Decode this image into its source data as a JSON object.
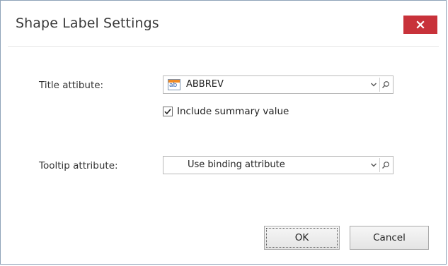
{
  "dialog": {
    "title": "Shape Label Settings",
    "close_icon": "close-icon"
  },
  "form": {
    "title_attribute": {
      "label": "Title attibute:",
      "value": "ABBREV",
      "icon": "text-attribute-icon",
      "icon_text": "ab"
    },
    "include_summary": {
      "label": "Include summary value",
      "checked": true
    },
    "tooltip_attribute": {
      "label": "Tooltip attribute:",
      "value": "Use binding attribute"
    }
  },
  "buttons": {
    "ok": "OK",
    "cancel": "Cancel"
  },
  "colors": {
    "close_button": "#c8323a",
    "icon_accent": "#f08a24"
  }
}
